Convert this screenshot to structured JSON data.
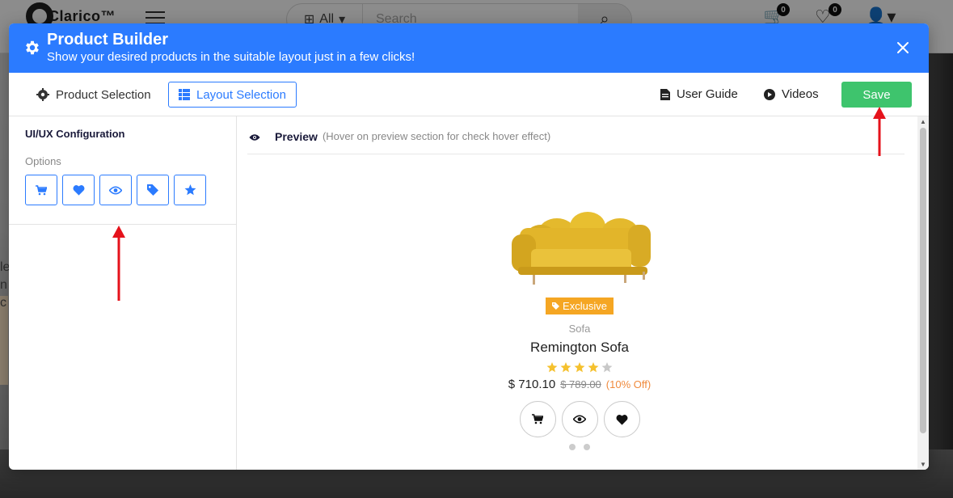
{
  "background": {
    "logo_text": "Clarico™",
    "search": {
      "category": "All",
      "placeholder": "Search"
    },
    "cart_count": "0",
    "wishlist_count": "0",
    "side_text": [
      "le",
      "n",
      "c"
    ]
  },
  "modal": {
    "title": "Product Builder",
    "subtitle": "Show your desired products in the suitable layout just in a few clicks!",
    "tabs": {
      "product_selection": "Product Selection",
      "layout_selection": "Layout Selection"
    },
    "links": {
      "user_guide": "User Guide",
      "videos": "Videos"
    },
    "save_label": "Save"
  },
  "config": {
    "title": "UI/UX Configuration",
    "options_label": "Options",
    "options": [
      "cart-icon",
      "heart-icon",
      "eye-icon",
      "tag-icon",
      "star-icon"
    ]
  },
  "preview": {
    "title": "Preview",
    "hint": "(Hover on preview section for check hover effect)",
    "product": {
      "badge": "Exclusive",
      "category": "Sofa",
      "name": "Remington Sofa",
      "rating": 4,
      "rating_max": 5,
      "price": "$ 710.10",
      "old_price": "$ 789.00",
      "discount": "(10% Off)"
    }
  },
  "colors": {
    "primary": "#2b7bff",
    "save": "#3ec46d",
    "badge": "#f5a623",
    "star": "#f5c12e",
    "discount": "#f08a3c",
    "annotation_arrow": "#e5121b"
  }
}
